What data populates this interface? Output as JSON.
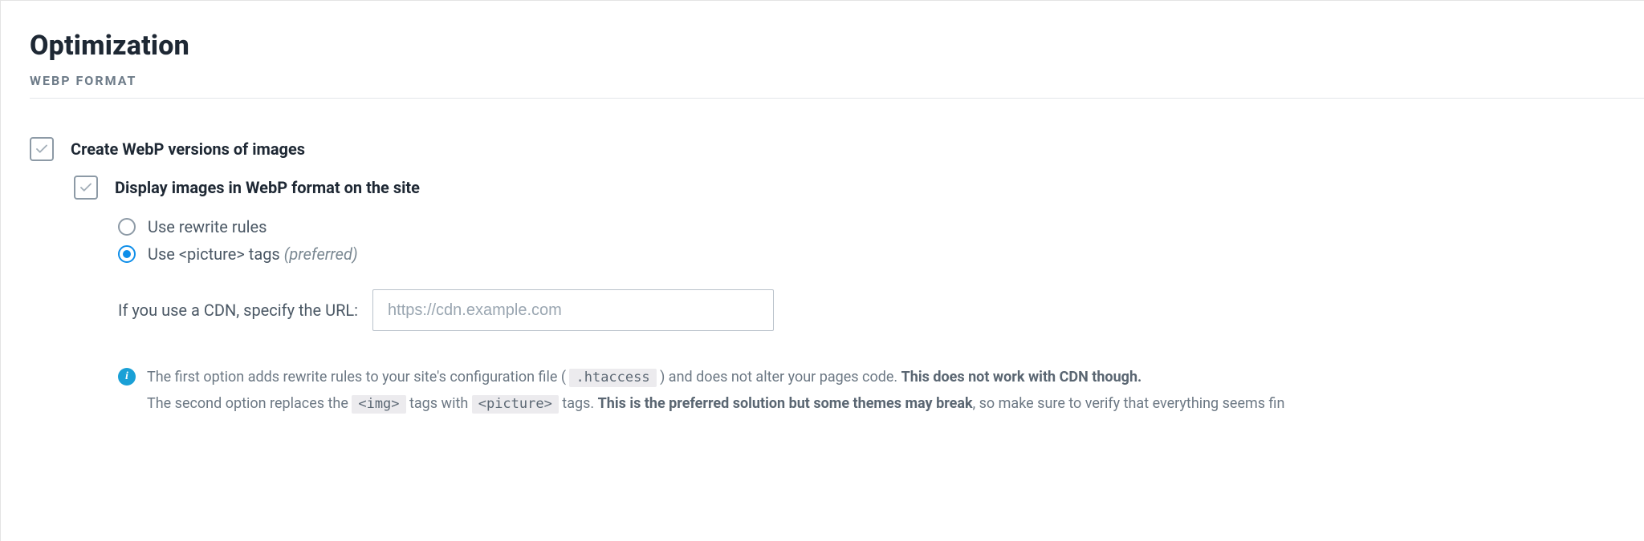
{
  "page": {
    "title": "Optimization"
  },
  "section": {
    "header": "WEBP FORMAT"
  },
  "options": {
    "create_webp": {
      "label": "Create WebP versions of images",
      "checked": true
    },
    "display_webp": {
      "label": "Display images in WebP format on the site",
      "checked": true,
      "radios": {
        "rewrite": {
          "label": "Use rewrite rules",
          "selected": false
        },
        "picture": {
          "label_prefix": "Use ",
          "tag": "<picture>",
          "label_suffix": " tags ",
          "preferred": "(preferred)",
          "selected": true
        }
      },
      "cdn": {
        "label": "If you use a CDN, specify the URL:",
        "placeholder": "https://cdn.example.com",
        "value": ""
      }
    }
  },
  "info": {
    "line1_a": "The first option adds rewrite rules to your site's configuration file ( ",
    "line1_code": ".htaccess",
    "line1_b": " ) and does not alter your pages code. ",
    "line1_strong": "This does not work with CDN though.",
    "line2_a": "The second option replaces the ",
    "line2_code1": "<img>",
    "line2_b": " tags with ",
    "line2_code2": "<picture>",
    "line2_c": " tags. ",
    "line2_strong": "This is the preferred solution but some themes may break",
    "line2_d": ", so make sure to verify that everything seems fin"
  }
}
